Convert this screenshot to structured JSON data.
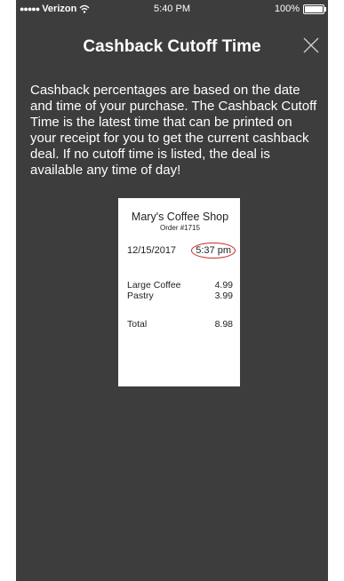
{
  "status_bar": {
    "signal": "●●●●●",
    "carrier": "Verizon",
    "time": "5:40 PM",
    "battery": "100%",
    "battery_level": 1.0
  },
  "header": {
    "title": "Cashback Cutoff Time",
    "close_icon": "close-icon"
  },
  "description": "Cashback percentages are based on the date and time of your purchase. The Cashback Cutoff Time is the latest time that can be printed on your receipt for you to get the current cashback deal. If no cutoff time is listed, the deal is available any time of day!",
  "receipt": {
    "shop_name": "Mary's Coffee Shop",
    "order": "Order #1715",
    "date": "12/15/2017",
    "time": "5:37 pm",
    "items": [
      {
        "name": "Large Coffee",
        "price": "4.99"
      },
      {
        "name": "Pastry",
        "price": "3.99"
      }
    ],
    "total_label": "Total",
    "total_value": "8.98"
  },
  "colors": {
    "background": "#3d3d3d",
    "highlight_circle": "#cc2a2a"
  }
}
